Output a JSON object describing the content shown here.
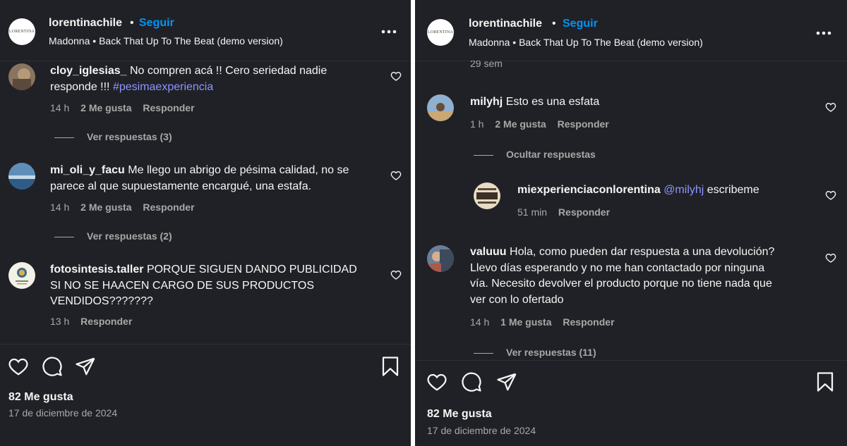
{
  "left": {
    "header": {
      "username": "lorentinachile",
      "dot": "•",
      "follow_label": "Seguir",
      "song_artist": "Madonna",
      "song_separator": "•",
      "song_title": "Back That Up To The Beat (demo version)",
      "avatar_text": "LORENTINA"
    },
    "comments": [
      {
        "username": "cloy_iglesias_",
        "text": "No compren acá !! Cero seriedad nadie",
        "text2": "responde !!!",
        "tag": "#pesimaexperiencia",
        "time": "14 h",
        "likes": "2 Me gusta",
        "reply": "Responder",
        "replies": "Ver respuestas (3)"
      },
      {
        "username": "mi_oli_y_facu",
        "text": "Me llego un abrigo de pésima calidad, no se",
        "text2": "parece al que supuestamente encargué, una estafa.",
        "time": "14 h",
        "likes": "2 Me gusta",
        "reply": "Responder",
        "replies": "Ver respuestas (2)"
      },
      {
        "username": "fotosintesis.taller",
        "text": "PORQUE SIGUEN DANDO PUBLICIDAD",
        "text2": "SI NO SE HAACEN CARGO DE SUS PRODUCTOS",
        "text3": "VENDIDOS???????",
        "time": "13 h",
        "reply": "Responder"
      }
    ],
    "footer": {
      "likes": "82 Me gusta",
      "date": "17 de diciembre de 2024"
    }
  },
  "right": {
    "header": {
      "username": "lorentinachile",
      "dot": "•",
      "follow_label": "Seguir",
      "song_artist": "Madonna",
      "song_separator": "•",
      "song_title": "Back That Up To The Beat (demo version)",
      "avatar_text": "LORENTINA"
    },
    "partial_time": "29 sem",
    "comments": [
      {
        "username": "milyhj",
        "text": "Esto es una esfata",
        "time": "1 h",
        "likes": "2 Me gusta",
        "reply": "Responder",
        "replies": "Ocultar respuestas"
      },
      {
        "username": "miexperienciaconlorentina",
        "mention": "@milyhj",
        "text": "escribeme",
        "time": "51 min",
        "reply": "Responder"
      },
      {
        "username": "valuuu",
        "text": "Hola, como pueden dar respuesta a una devolución?",
        "text2": "Llevo días esperando y no me han contactado por ninguna",
        "text3": "vía. Necesito devolver el producto porque no tiene nada que",
        "text4": "ver con lo ofertado",
        "time": "14 h",
        "likes": "1 Me gusta",
        "reply": "Responder",
        "replies": "Ver respuestas (11)"
      }
    ],
    "footer": {
      "likes": "82 Me gusta",
      "date": "17 de diciembre de 2024"
    }
  },
  "icons": {
    "like": "heart-icon",
    "comment": "comment-icon",
    "share": "paper-plane-icon",
    "save": "bookmark-icon",
    "more": "more-horizontal-icon"
  },
  "colors": {
    "background": "#202126",
    "follow": "#0095f6",
    "hashtag": "#8c95ff",
    "muted": "#a8a8a8"
  }
}
